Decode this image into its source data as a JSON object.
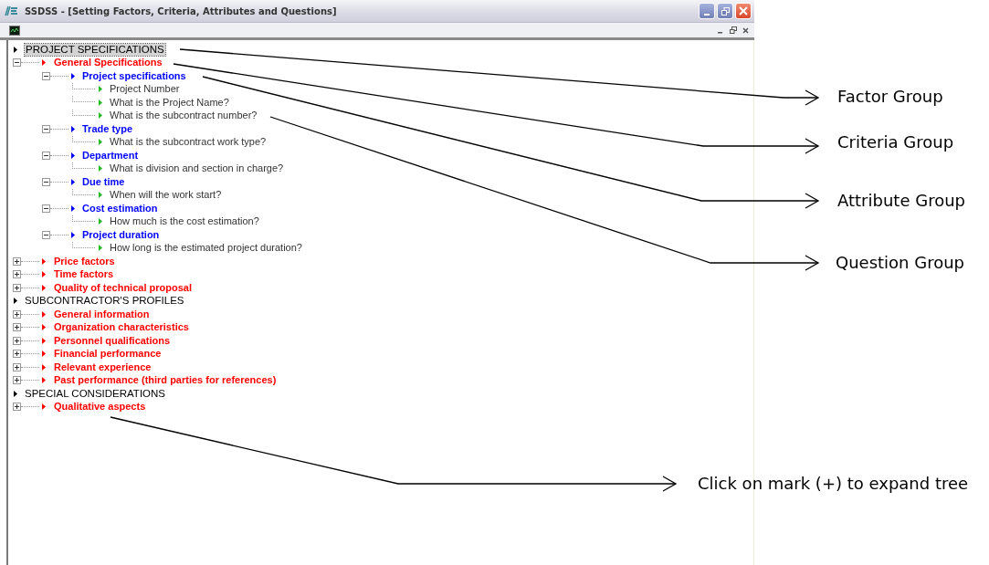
{
  "window": {
    "title": "SSDSS - [Setting Factors, Criteria, Attributes and Questions]"
  },
  "tree": [
    {
      "label": "PROJECT SPECIFICATIONS",
      "kind": "factor",
      "selected": true,
      "children": [
        {
          "label": "General Specifications",
          "kind": "criteria",
          "expanded": true,
          "selected": false,
          "children": [
            {
              "label": "Project specifications",
              "kind": "attribute",
              "expanded": true,
              "selected": false,
              "children": [
                {
                  "label": "Project Number",
                  "kind": "question",
                  "selected": false
                },
                {
                  "label": "What is the Project Name?",
                  "kind": "question",
                  "selected": false
                },
                {
                  "label": "What is the subcontract number?",
                  "kind": "question",
                  "selected": false
                }
              ]
            },
            {
              "label": "Trade type",
              "kind": "attribute",
              "expanded": true,
              "selected": false,
              "children": [
                {
                  "label": "What is the subcontract work type?",
                  "kind": "question",
                  "selected": false
                }
              ]
            },
            {
              "label": "Department",
              "kind": "attribute",
              "expanded": true,
              "selected": false,
              "children": [
                {
                  "label": "What is division and section in charge?",
                  "kind": "question",
                  "selected": false
                }
              ]
            },
            {
              "label": "Due time",
              "kind": "attribute",
              "expanded": true,
              "selected": false,
              "children": [
                {
                  "label": "When will the work start?",
                  "kind": "question",
                  "selected": false
                }
              ]
            },
            {
              "label": "Cost estimation",
              "kind": "attribute",
              "expanded": true,
              "selected": false,
              "children": [
                {
                  "label": "How much is the cost estimation?",
                  "kind": "question",
                  "selected": false
                }
              ]
            },
            {
              "label": "Project duration",
              "kind": "attribute",
              "expanded": true,
              "selected": false,
              "children": [
                {
                  "label": "How long is the estimated project duration?",
                  "kind": "question",
                  "selected": false
                }
              ]
            }
          ]
        },
        {
          "label": "Price factors",
          "kind": "criteria",
          "expanded": false,
          "selected": false
        },
        {
          "label": "Time factors",
          "kind": "criteria",
          "expanded": false,
          "selected": false
        },
        {
          "label": "Quality of technical proposal",
          "kind": "criteria",
          "expanded": false,
          "selected": false
        }
      ]
    },
    {
      "label": "SUBCONTRACTOR'S PROFILES",
      "kind": "factor",
      "selected": false,
      "children": [
        {
          "label": "General information",
          "kind": "criteria",
          "expanded": false,
          "selected": false
        },
        {
          "label": "Organization characteristics",
          "kind": "criteria",
          "expanded": false,
          "selected": false
        },
        {
          "label": "Personnel qualifications",
          "kind": "criteria",
          "expanded": false,
          "selected": false
        },
        {
          "label": "Financial performance",
          "kind": "criteria",
          "expanded": false,
          "selected": false
        },
        {
          "label": "Relevant experience",
          "kind": "criteria",
          "expanded": false,
          "selected": false
        },
        {
          "label": "Past performance (third parties for references)",
          "kind": "criteria",
          "expanded": false,
          "selected": false
        }
      ]
    },
    {
      "label": "SPECIAL CONSIDERATIONS",
      "kind": "factor",
      "selected": false,
      "children": [
        {
          "label": "Qualitative aspects",
          "kind": "criteria",
          "expanded": false,
          "selected": false
        }
      ]
    }
  ],
  "annotations": [
    {
      "label": "Factor Group"
    },
    {
      "label": "Criteria Group"
    },
    {
      "label": "Attribute Group"
    },
    {
      "label": "Question Group"
    },
    {
      "label": "Click on mark (+) to expand tree"
    }
  ]
}
